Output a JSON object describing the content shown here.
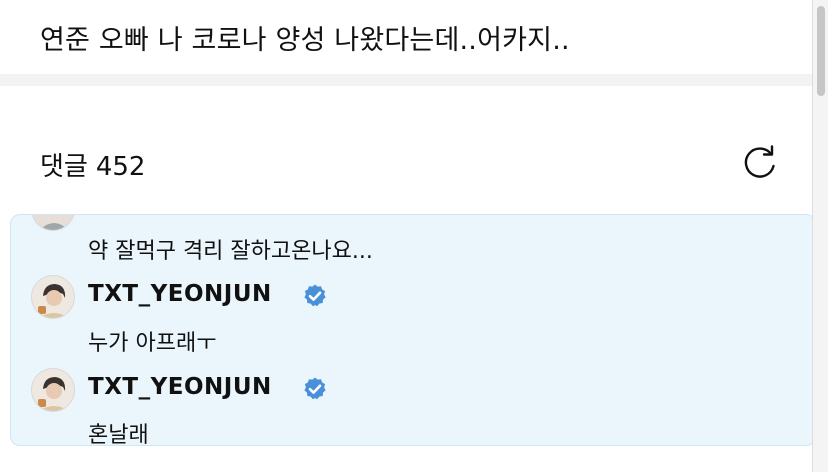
{
  "post": {
    "text": "연준 오빠 나 코로나 양성 나왔다는데..어카지.."
  },
  "comments": {
    "label": "댓글",
    "count": "452",
    "refresh_icon": "refresh-icon"
  },
  "thread": {
    "partial_reply_text": "약 잘먹구 격리 잘하고온나요...",
    "replies": [
      {
        "author": "TXT_YEONJUN",
        "verified": true,
        "text": "누가 아프래ㅜ"
      },
      {
        "author": "TXT_YEONJUN",
        "verified": true,
        "text": "혼날래"
      }
    ]
  },
  "colors": {
    "highlight_bg": "#eaf6fc",
    "verified_blue": "#4a90d9"
  }
}
